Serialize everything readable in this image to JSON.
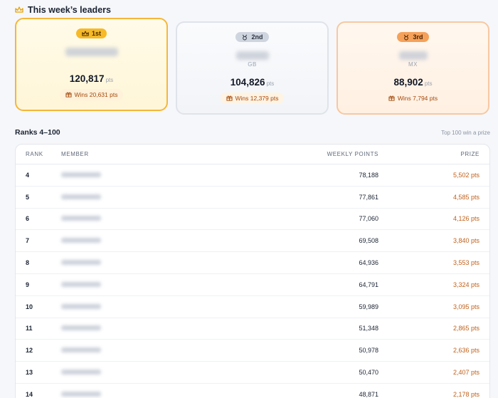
{
  "leaders": {
    "title": "This week’s leaders",
    "podium": [
      {
        "badge": "1st",
        "sub": "",
        "points": "120,817",
        "unit": "pts",
        "wins": "Wins 20,631 pts"
      },
      {
        "badge": "2nd",
        "sub": "GB",
        "points": "104,826",
        "unit": "pts",
        "wins": "Wins 12,379 pts"
      },
      {
        "badge": "3rd",
        "sub": "MX",
        "points": "88,902",
        "unit": "pts",
        "wins": "Wins 7,794 pts"
      }
    ]
  },
  "ranks": {
    "title": "Ranks 4–100",
    "hint": "Top 100 win a prize",
    "columns": {
      "rank": "RANK",
      "member": "MEMBER",
      "points": "WEEKLY POINTS",
      "prize": "PRIZE"
    },
    "rows": [
      {
        "rank": "4",
        "points": "78,188",
        "prize": "5,502 pts"
      },
      {
        "rank": "5",
        "points": "77,861",
        "prize": "4,585 pts"
      },
      {
        "rank": "6",
        "points": "77,060",
        "prize": "4,126 pts"
      },
      {
        "rank": "7",
        "points": "69,508",
        "prize": "3,840 pts"
      },
      {
        "rank": "8",
        "points": "64,936",
        "prize": "3,553 pts"
      },
      {
        "rank": "9",
        "points": "64,791",
        "prize": "3,324 pts"
      },
      {
        "rank": "10",
        "points": "59,989",
        "prize": "3,095 pts"
      },
      {
        "rank": "11",
        "points": "51,348",
        "prize": "2,865 pts"
      },
      {
        "rank": "12",
        "points": "50,978",
        "prize": "2,636 pts"
      },
      {
        "rank": "13",
        "points": "50,470",
        "prize": "2,407 pts"
      },
      {
        "rank": "14",
        "points": "48,871",
        "prize": "2,178 pts"
      }
    ]
  },
  "colors": {
    "gold": "#f6b928",
    "silver": "#cfd5df",
    "bronze": "#f5a15a",
    "prize": "#c0601a"
  },
  "icons": {
    "leaders": "crown-icon",
    "first": "crown-icon",
    "second": "medal-icon",
    "third": "medal-icon",
    "wins": "gift-icon"
  }
}
